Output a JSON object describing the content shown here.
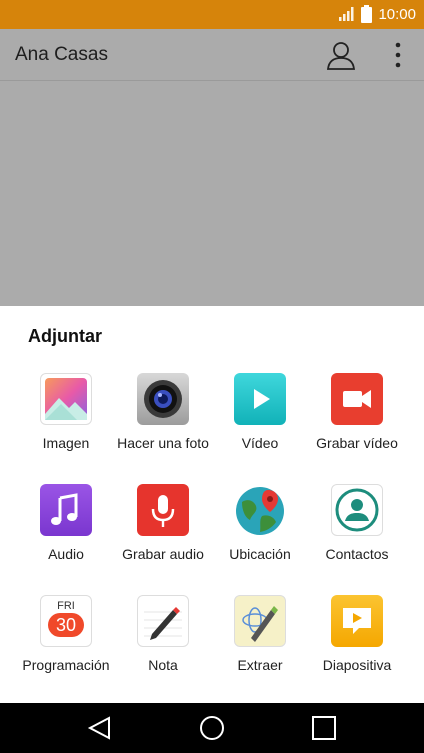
{
  "status": {
    "time": "10:00",
    "accent": "#d6840b"
  },
  "app_bar": {
    "title": "Ana Casas",
    "profile_icon": "person-icon",
    "menu_icon": "more-vert-icon"
  },
  "sheet": {
    "title": "Adjuntar",
    "items": [
      {
        "label": "Imagen",
        "icon": "gallery-icon"
      },
      {
        "label": "Hacer una foto",
        "icon": "camera-icon"
      },
      {
        "label": "Vídeo",
        "icon": "video-play-icon"
      },
      {
        "label": "Grabar vídeo",
        "icon": "video-record-icon"
      },
      {
        "label": "Audio",
        "icon": "music-note-icon"
      },
      {
        "label": "Grabar audio",
        "icon": "microphone-icon"
      },
      {
        "label": "Ubicación",
        "icon": "globe-pin-icon"
      },
      {
        "label": "Contactos",
        "icon": "contact-icon"
      },
      {
        "label": "Programación",
        "icon": "calendar-icon",
        "calendar_day": "FRI",
        "calendar_date": "30"
      },
      {
        "label": "Nota",
        "icon": "note-pen-icon"
      },
      {
        "label": "Extraer",
        "icon": "sketch-icon"
      },
      {
        "label": "Diapositiva",
        "icon": "slideshow-icon"
      }
    ]
  },
  "nav": {
    "back": "back-icon",
    "home": "home-icon",
    "recents": "recents-icon"
  }
}
